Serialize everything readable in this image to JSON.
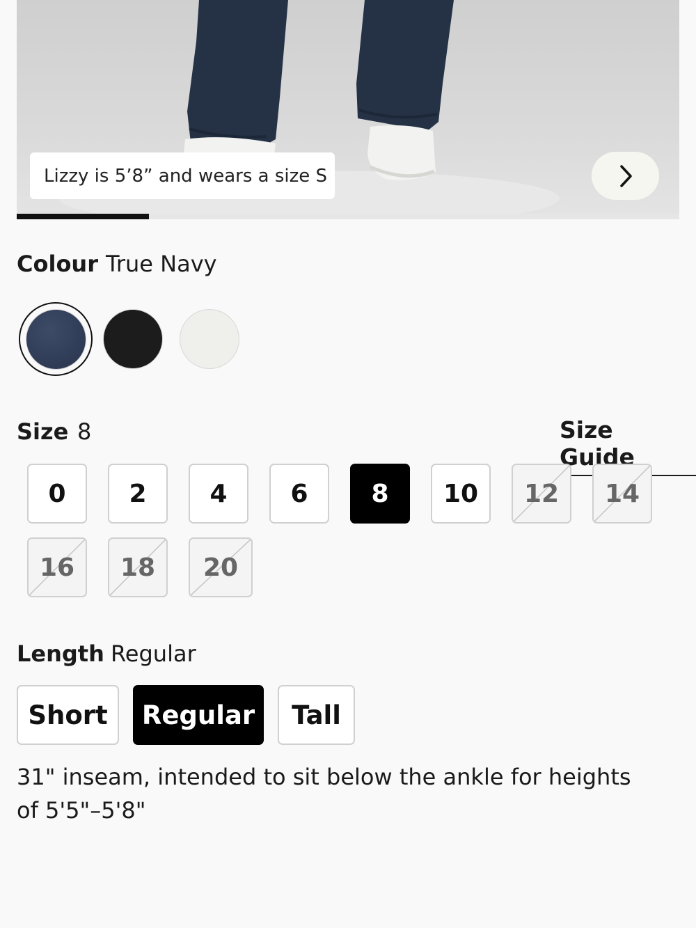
{
  "hero": {
    "caption": "Lizzy is 5’8” and wears a size S",
    "next_icon": "chevron-right-icon",
    "progress": 0.2
  },
  "colour": {
    "label": "Colour",
    "selected": "True Navy",
    "swatches": [
      {
        "name": "True Navy",
        "hex": "#2f3b55",
        "selected": true
      },
      {
        "name": "Black",
        "hex": "#1c1c1c",
        "selected": false
      },
      {
        "name": "White",
        "hex": "#efefec",
        "selected": false
      }
    ]
  },
  "size": {
    "label": "Size",
    "selected": "8",
    "guide_label": "Size Guide",
    "options": [
      {
        "label": "0",
        "state": "available"
      },
      {
        "label": "2",
        "state": "available"
      },
      {
        "label": "4",
        "state": "available"
      },
      {
        "label": "6",
        "state": "available"
      },
      {
        "label": "8",
        "state": "selected"
      },
      {
        "label": "10",
        "state": "available"
      },
      {
        "label": "12",
        "state": "soldout"
      },
      {
        "label": "14",
        "state": "soldout"
      },
      {
        "label": "16",
        "state": "soldout"
      },
      {
        "label": "18",
        "state": "soldout"
      },
      {
        "label": "20",
        "state": "soldout"
      }
    ]
  },
  "length": {
    "label": "Length",
    "selected": "Regular",
    "options": [
      {
        "label": "Short",
        "state": "available"
      },
      {
        "label": "Regular",
        "state": "selected"
      },
      {
        "label": "Tall",
        "state": "available"
      }
    ],
    "description": "31\" inseam, intended to sit below the ankle for heights of 5'5\"–5'8\""
  }
}
